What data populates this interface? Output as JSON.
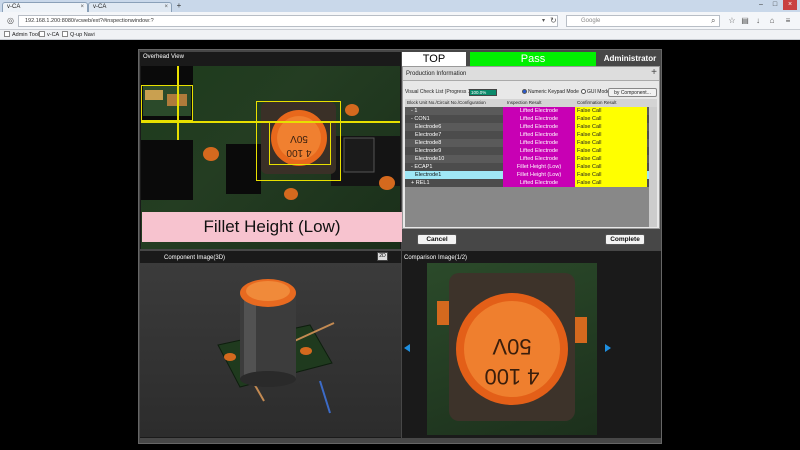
{
  "browser": {
    "tabs": [
      {
        "label": "v-CA"
      },
      {
        "label": "v-CA"
      }
    ],
    "new_tab": "+",
    "url": "192.168.1.200:8080/vcweb/ext?#inspectionwindow:?",
    "search_placeholder": "Google",
    "bookmarks": [
      {
        "label": "Admin Tool"
      },
      {
        "label": "v-CA"
      },
      {
        "label": "Q-up Navi"
      }
    ]
  },
  "header": {
    "top_label": "TOP",
    "status_label": "Pass",
    "user_label": "Administrator"
  },
  "overhead": {
    "title": "Overhead View",
    "caption": "Fillet Height (Low)"
  },
  "production": {
    "title": "Production Information",
    "plus": "+",
    "check_list_label": "Visual Check List (Progress 1/)",
    "progress_text": "100.0%",
    "mode_numeric": "Numeric Keypad Mode",
    "mode_gui": "GUI Mode",
    "by_component": "by Component...",
    "columns": [
      "Block Unit No./Circuit No./Configuration",
      "Inspection Result",
      "Confirmation Result"
    ],
    "rows": [
      {
        "name": "- 1",
        "inspection": "Lifted Electrode",
        "confirmation": "False Call"
      },
      {
        "name": "- CON1",
        "inspection": "Lifted Electrode",
        "confirmation": "False Call"
      },
      {
        "name": "Electrode6",
        "inspection": "Lifted Electrode",
        "confirmation": "False Call"
      },
      {
        "name": "Electrode7",
        "inspection": "Lifted Electrode",
        "confirmation": "False Call"
      },
      {
        "name": "Electrode8",
        "inspection": "Lifted Electrode",
        "confirmation": "False Call"
      },
      {
        "name": "Electrode9",
        "inspection": "Lifted Electrode",
        "confirmation": "False Call"
      },
      {
        "name": "Electrode10",
        "inspection": "Lifted Electrode",
        "confirmation": "False Call"
      },
      {
        "name": "- ECAP1",
        "inspection": "Fillet Height (Low)",
        "confirmation": "False Call"
      },
      {
        "name": "Electrode1",
        "inspection": "Fillet Height (Low)",
        "confirmation": "False Call"
      },
      {
        "name": "+ REL1",
        "inspection": "Lifted Electrode",
        "confirmation": "False Call"
      }
    ]
  },
  "actions": {
    "cancel": "Cancel",
    "complete": "Complete"
  },
  "component_image": {
    "title": "Component Image(3D)",
    "toggle_2d": "2D"
  },
  "comparison_image": {
    "title": "Comparison Image(1/2)"
  },
  "colors": {
    "pass": "#00f000",
    "lifted": "#c800b4",
    "false_call": "#ffff00",
    "selected": "#9fe7f5"
  }
}
